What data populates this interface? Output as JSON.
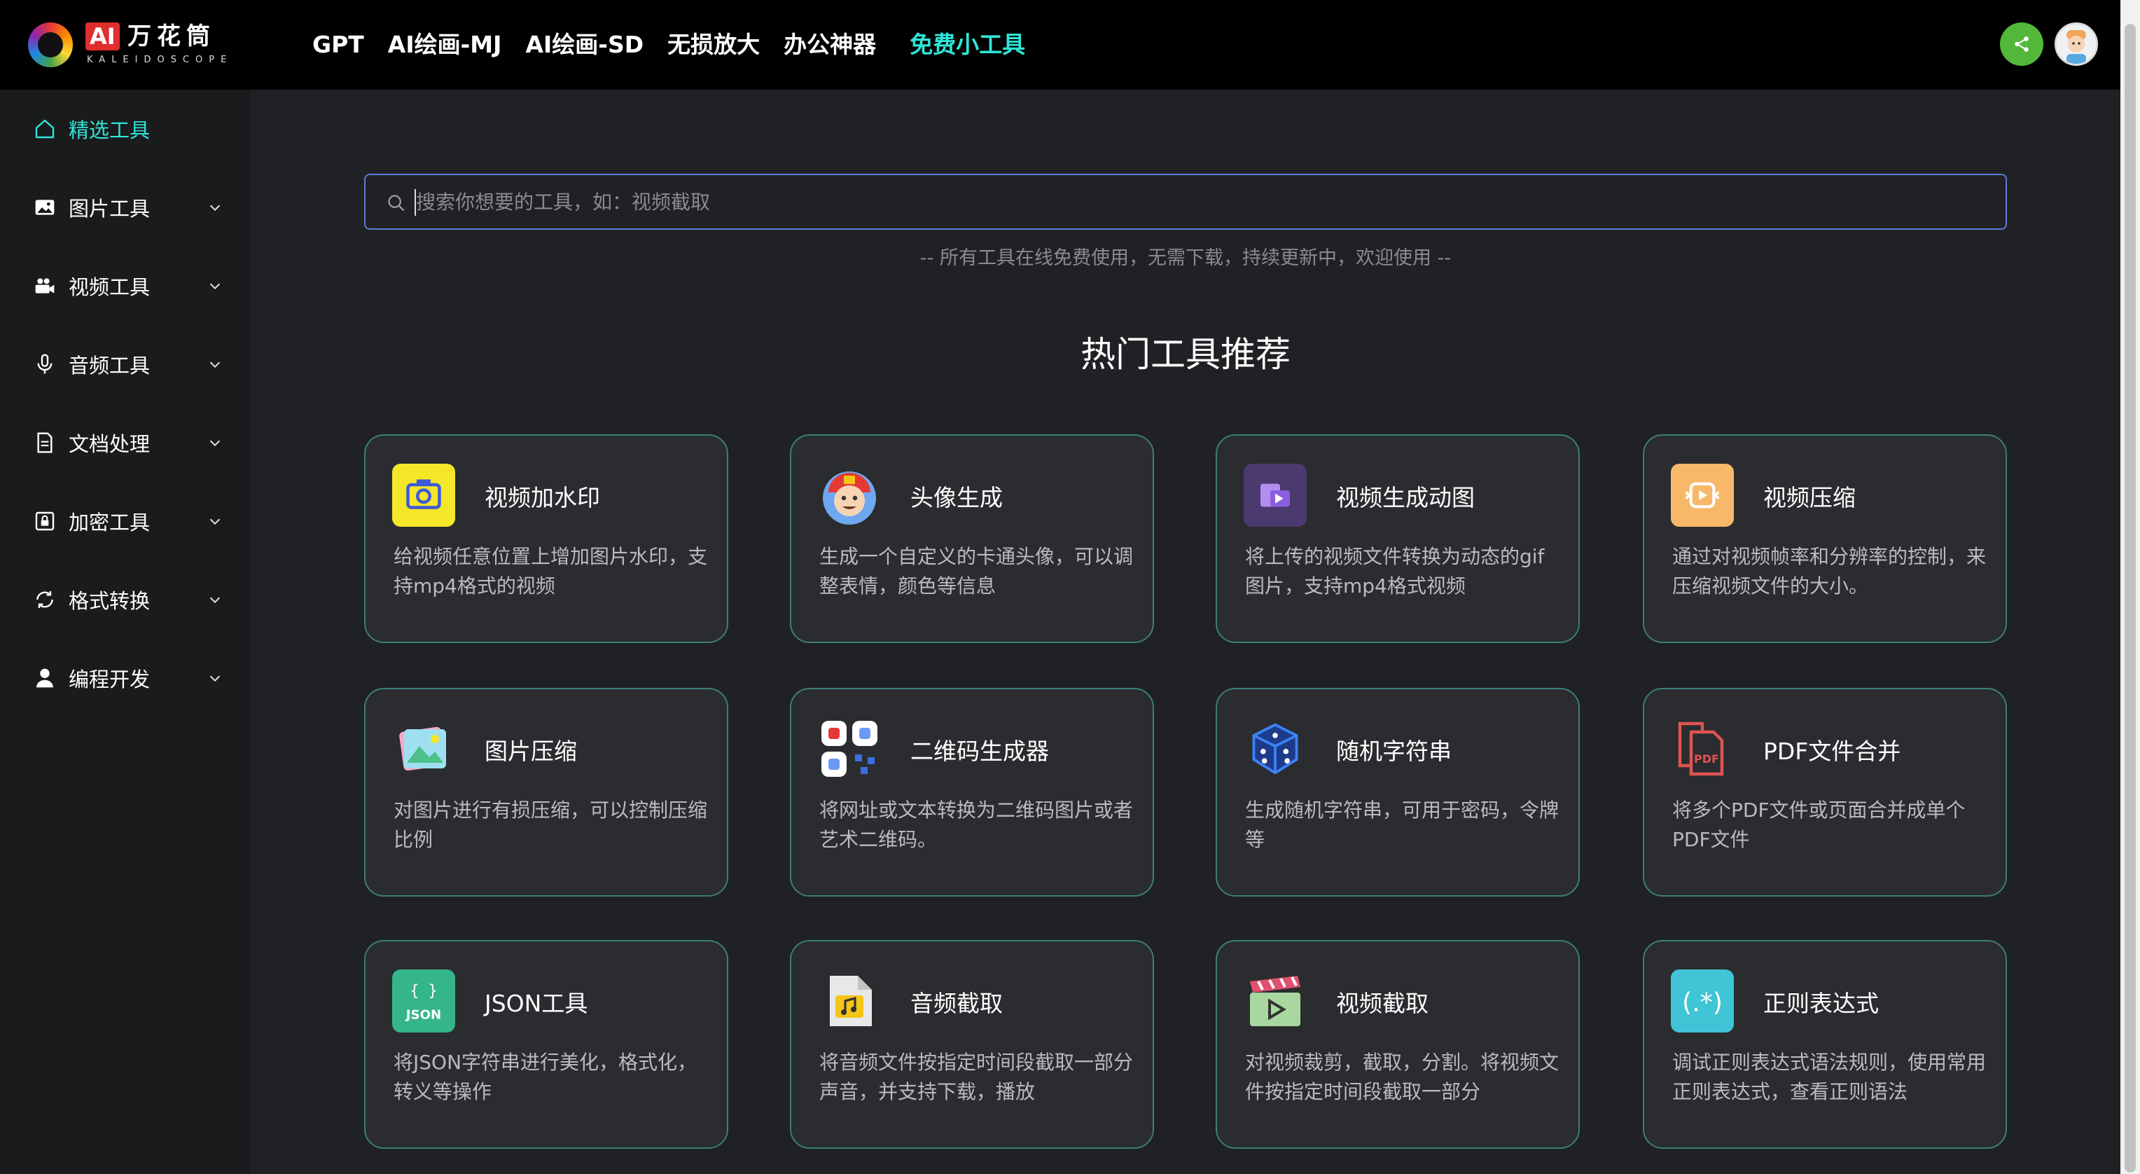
{
  "brand": {
    "badge": "AI",
    "name_cn": "万花筒",
    "name_en": "KALEIDOSCOPE"
  },
  "nav": [
    {
      "label": "GPT"
    },
    {
      "label": "AI绘画-MJ"
    },
    {
      "label": "AI绘画-SD"
    },
    {
      "label": "无损放大"
    },
    {
      "label": "办公神器"
    },
    {
      "label": "免费小工具",
      "active": true
    }
  ],
  "sidebar": {
    "items": [
      {
        "label": "精选工具",
        "icon": "home-icon",
        "active": true
      },
      {
        "label": "图片工具",
        "icon": "image-icon"
      },
      {
        "label": "视频工具",
        "icon": "video-camera-icon"
      },
      {
        "label": "音频工具",
        "icon": "microphone-icon"
      },
      {
        "label": "文档处理",
        "icon": "document-icon"
      },
      {
        "label": "加密工具",
        "icon": "encrypt-icon"
      },
      {
        "label": "格式转换",
        "icon": "convert-icon"
      },
      {
        "label": "编程开发",
        "icon": "user-icon"
      }
    ]
  },
  "search": {
    "placeholder": "搜索你想要的工具，如：视频截取"
  },
  "tagline": "-- 所有工具在线免费使用，无需下载，持续更新中，欢迎使用 --",
  "section_title": "热门工具推荐",
  "tools": [
    {
      "title": "视频加水印",
      "desc": "给视频任意位置上增加图片水印，支持mp4格式的视频",
      "icon": "video-watermark-icon",
      "color": "#f5e628"
    },
    {
      "title": "头像生成",
      "desc": "生成一个自定义的卡通头像，可以调整表情，颜色等信息",
      "icon": "avatar-generator-icon",
      "color": "#e53935"
    },
    {
      "title": "视频生成动图",
      "desc": "将上传的视频文件转换为动态的gif图片，支持mp4格式视频",
      "icon": "video-to-gif-icon",
      "color": "#4a3a6e"
    },
    {
      "title": "视频压缩",
      "desc": "通过对视频帧率和分辨率的控制，来压缩视频文件的大小。",
      "icon": "video-compress-icon",
      "color": "#f8b86a"
    },
    {
      "title": "图片压缩",
      "desc": "对图片进行有损压缩，可以控制压缩比例",
      "icon": "image-compress-icon",
      "color": "#63c6a8"
    },
    {
      "title": "二维码生成器",
      "desc": "将网址或文本转换为二维码图片或者艺术二维码。",
      "icon": "qr-code-icon",
      "color": "#6a9af5"
    },
    {
      "title": "随机字符串",
      "desc": "生成随机字符串，可用于密码，令牌等",
      "icon": "dice-icon",
      "color": "#3b6fe0"
    },
    {
      "title": "PDF文件合并",
      "desc": "将多个PDF文件或页面合并成单个PDF文件",
      "icon": "pdf-merge-icon",
      "color": "#e05353"
    },
    {
      "title": "JSON工具",
      "desc": "将JSON字符串进行美化，格式化，转义等操作",
      "icon": "json-icon",
      "color": "#35b58a"
    },
    {
      "title": "音频截取",
      "desc": "将音频文件按指定时间段截取一部分声音，并支持下载，播放",
      "icon": "audio-clip-icon",
      "color": "#e8dd9a"
    },
    {
      "title": "视频截取",
      "desc": "对视频裁剪，截取，分割。将视频文件按指定时间段截取一部分",
      "icon": "video-clip-icon",
      "color": "#a8d8a0"
    },
    {
      "title": "正则表达式",
      "desc": "调试正则表达式语法规则，使用常用正则表达式，查看正则语法",
      "icon": "regex-icon",
      "color": "#3fc5d6"
    }
  ]
}
